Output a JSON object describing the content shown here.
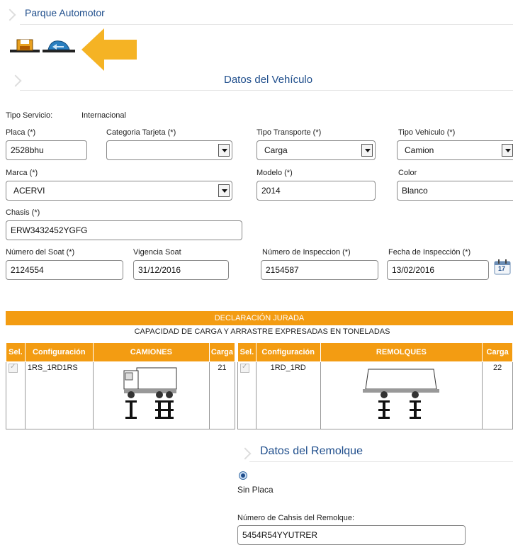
{
  "header": {
    "title": "Parque Automotor"
  },
  "toolbar": {
    "save_icon": "save-icon",
    "back_icon": "back-icon",
    "accent": "#f5b324"
  },
  "vehiculo": {
    "section_title": "Datos del Vehículo",
    "tipo_servicio_label": "Tipo Servicio:",
    "tipo_servicio_value": "Internacional",
    "placa_label": "Placa (*)",
    "placa_value": "2528bhu",
    "categoria_label": "Categoria Tarjeta (*)",
    "categoria_value": "",
    "tipo_transporte_label": "Tipo Transporte (*)",
    "tipo_transporte_value": "Carga",
    "tipo_vehiculo_label": "Tipo Vehiculo (*)",
    "tipo_vehiculo_value": "Camion",
    "marca_label": "Marca (*)",
    "marca_value": "ACERVI",
    "modelo_label": "Modelo (*)",
    "modelo_value": "2014",
    "color_label": "Color",
    "color_value": "Blanco",
    "chasis_label": "Chasis (*)",
    "chasis_value": "ERW3432452YGFG",
    "soat_label": "Número del Soat (*)",
    "soat_value": "2124554",
    "vigencia_label": "Vigencia Soat",
    "vigencia_value": "31/12/2016",
    "inspeccion_label": "Número de Inspeccion (*)",
    "inspeccion_value": "2154587",
    "fecha_insp_label": "Fecha de Inspección (*)",
    "fecha_insp_value": "13/02/2016",
    "calendar_day": "17"
  },
  "declaracion": {
    "title": "DECLARACIÓN JURADA",
    "subtitle": "CAPACIDAD DE CARGA Y ARRASTRE EXPRESADAS EN TONELADAS",
    "camiones_headers": [
      "Sel.",
      "Configuración",
      "CAMIONES",
      "Carga"
    ],
    "remolques_headers": [
      "Sel.",
      "Configuración",
      "REMOLQUES",
      "Carga"
    ],
    "camion_config": "1RS_1RD1RS",
    "camion_carga": "21",
    "remolque_config": "1RD_1RD",
    "remolque_carga": "22"
  },
  "remolque": {
    "section_title": "Datos del Remolque",
    "sin_placa_label": "Sin Placa",
    "chasis_label": "Número de Cahsis del Remolque:",
    "chasis_value": "5454R54YYUTRER"
  }
}
